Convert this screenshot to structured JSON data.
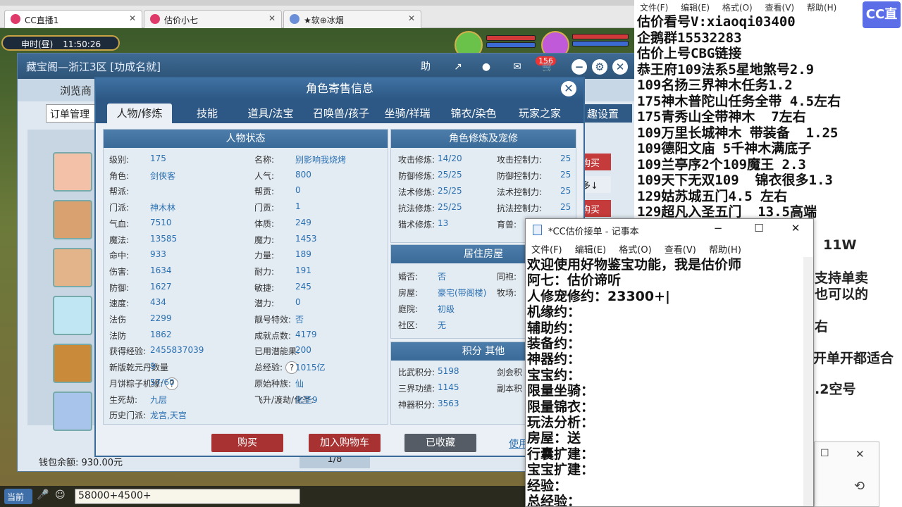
{
  "browser": {
    "tabs": [
      {
        "label": "CC直播1"
      },
      {
        "label": "估价小七"
      },
      {
        "label": "★软⊕冰烟"
      }
    ]
  },
  "game": {
    "time_label": "申时(昼)",
    "time_value": "11:50:26",
    "chat_input_value": "58000+4500+",
    "channel_label": "当前"
  },
  "cbg": {
    "title": "藏宝阁—浙江3区 [功成名就]",
    "help_label": "助",
    "badge_count": "156",
    "browse_label": "浏览商",
    "order_mgmt_label": "订单管理",
    "settings_label": "趣设置",
    "side_buttons": [
      "购买",
      "多↓",
      "购买"
    ],
    "wallet_label": "钱包余额: 930.00元",
    "pager": "1/8",
    "help_link": "使用"
  },
  "modal": {
    "title": "角色寄售信息",
    "tabs": [
      "人物/修炼",
      "技能",
      "道具/法宝",
      "召唤兽/孩子",
      "坐骑/祥瑞",
      "锦衣/染色",
      "玩家之家"
    ],
    "status_title": "人物状态",
    "status_left": [
      {
        "k": "级别:",
        "v": "175"
      },
      {
        "k": "角色:",
        "v": "剑侠客"
      },
      {
        "k": "帮派:",
        "v": ""
      },
      {
        "k": "门派:",
        "v": "神木林"
      },
      {
        "k": "气血:",
        "v": "7510"
      },
      {
        "k": "魔法:",
        "v": "13585"
      },
      {
        "k": "命中:",
        "v": "933"
      },
      {
        "k": "伤害:",
        "v": "1634"
      },
      {
        "k": "防御:",
        "v": "1627"
      },
      {
        "k": "速度:",
        "v": "434"
      },
      {
        "k": "法伤",
        "v": "2299"
      },
      {
        "k": "法防",
        "v": "1862"
      },
      {
        "k": "获得经验:",
        "v": "2455837039"
      },
      {
        "k": "新版乾元丹数量",
        "v": "9"
      },
      {
        "k": "月饼粽子机缘:",
        "v": "57/60"
      },
      {
        "k": "生死劫:",
        "v": "九层"
      },
      {
        "k": "历史门派:",
        "v": "龙宫,天宫"
      }
    ],
    "status_right": [
      {
        "k": "名称:",
        "v": "别影响我烧烤"
      },
      {
        "k": "人气:",
        "v": "800"
      },
      {
        "k": "帮贡:",
        "v": "0"
      },
      {
        "k": "门贡:",
        "v": "1"
      },
      {
        "k": "体质:",
        "v": "249"
      },
      {
        "k": "魔力:",
        "v": "1453"
      },
      {
        "k": "力量:",
        "v": "189"
      },
      {
        "k": "耐力:",
        "v": "191"
      },
      {
        "k": "敏捷:",
        "v": "245"
      },
      {
        "k": "潜力:",
        "v": "0"
      },
      {
        "k": "靓号特效:",
        "v": "否"
      },
      {
        "k": "成就点数:",
        "v": "4179"
      },
      {
        "k": "已用潜能果:",
        "v": "200"
      },
      {
        "k": "总经验:",
        "v": "1015亿"
      },
      {
        "k": "原始种族:",
        "v": "仙"
      },
      {
        "k": "飞升/渡劫/化圣:",
        "v": "化圣9"
      }
    ],
    "cult_title": "角色修炼及宠修",
    "cult_left": [
      {
        "k": "攻击修炼:",
        "v": "14/20"
      },
      {
        "k": "防御修炼:",
        "v": "25/25"
      },
      {
        "k": "法术修炼:",
        "v": "25/25"
      },
      {
        "k": "抗法修炼:",
        "v": "25/25"
      },
      {
        "k": "猎术修炼:",
        "v": "13"
      }
    ],
    "cult_right": [
      {
        "k": "攻击控制力:",
        "v": "25"
      },
      {
        "k": "防御控制力:",
        "v": "25"
      },
      {
        "k": "法术控制力:",
        "v": "25"
      },
      {
        "k": "抗法控制力:",
        "v": "25"
      },
      {
        "k": "育兽:",
        "v": ""
      }
    ],
    "house_title": "居住房屋",
    "house_left": [
      {
        "k": "婚否:",
        "v": "否"
      },
      {
        "k": "房屋:",
        "v": "豪宅(带阁楼)"
      },
      {
        "k": "庭院:",
        "v": "初级"
      },
      {
        "k": "社区:",
        "v": "无"
      }
    ],
    "house_right": [
      {
        "k": "同袍:",
        "v": ""
      },
      {
        "k": "牧场:",
        "v": ""
      }
    ],
    "score_title": "积分 其他",
    "score_left": [
      {
        "k": "比武积分:",
        "v": "5198"
      },
      {
        "k": "三界功绩:",
        "v": "1145"
      },
      {
        "k": "神器积分:",
        "v": "3563"
      }
    ],
    "score_right": [
      {
        "k": "剑会积",
        "v": ""
      },
      {
        "k": "副本积",
        "v": ""
      }
    ],
    "buttons": {
      "buy": "购买",
      "cart": "加入购物车",
      "fav": "已收藏"
    }
  },
  "right_notepad": {
    "menu": [
      "文件(F)",
      "编辑(E)",
      "格式(O)",
      "查看(V)",
      "帮助(H)"
    ],
    "lines": [
      "估价看号V:xiaoqi03400",
      "企鹅群15532283",
      "估价上号CBG链接",
      "恭王府109法系5星地煞号2.9",
      "109名扬三界神木任务1.2",
      "175神木普陀山任务全带 4.5左右",
      "175青秀山全带神木  7左右",
      "109万里长城神木 带装备  1.25",
      "109德阳文庙 5千神木满底子",
      "109兰亭序2个109魔王 2.3",
      "109天下无双109  锦衣很多1.3",
      "129姑苏城五门4.5 左右",
      "129超凡入圣五门  13.5高端"
    ],
    "partial_lines": [
      {
        "text": "11W"
      },
      {
        "text": "支持单卖"
      },
      {
        "text": "也可以的"
      },
      {
        "text": "右"
      },
      {
        "text": "开单开都适合"
      },
      {
        "text": ".2空号"
      }
    ],
    "logo_text": "CC直播"
  },
  "notepad": {
    "title": "*CC估价接单 - 记事本",
    "menu": [
      "文件(F)",
      "编辑(E)",
      "格式(O)",
      "查看(V)",
      "帮助(H)"
    ],
    "body": "欢迎使用好物鉴宝功能，我是估价师\n阿七：估价谛听\n人修宠修约：23300+|\n机缘约：\n辅助约：\n装备约：\n神器约：\n宝宝约：\n限量坐骑：\n限量锦衣：\n玩法分析：\n房屋：送\n行囊扩建：\n宝宝扩建：\n经验：\n总经验："
  }
}
